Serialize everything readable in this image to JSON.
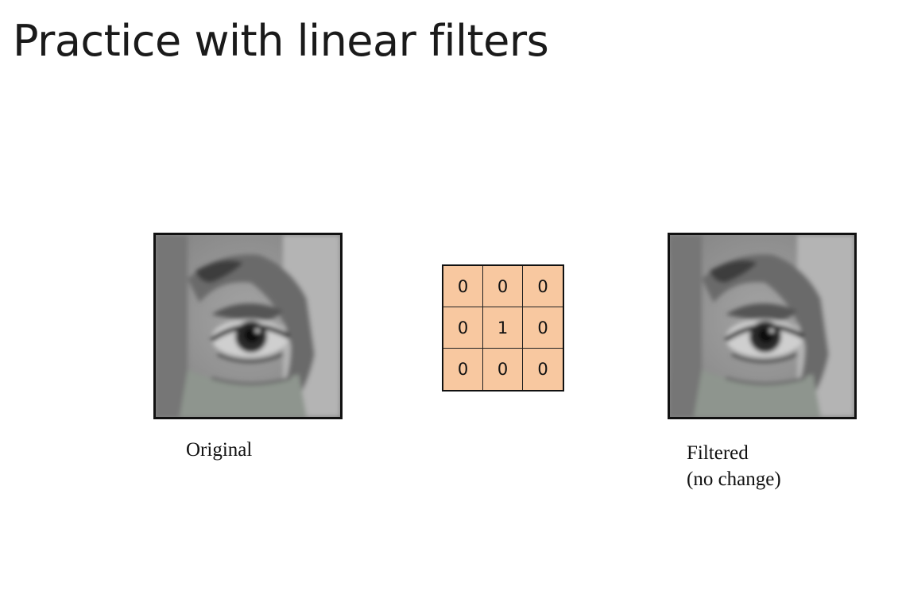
{
  "slide": {
    "title": "Practice with linear filters"
  },
  "original": {
    "caption": "Original"
  },
  "kernel": {
    "cells": [
      "0",
      "0",
      "0",
      "0",
      "1",
      "0",
      "0",
      "0",
      "0"
    ],
    "fill_color": "#f8c8a0"
  },
  "filtered": {
    "caption_line1": "Filtered",
    "caption_line2": "(no change)"
  }
}
